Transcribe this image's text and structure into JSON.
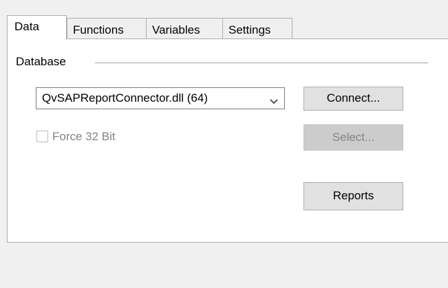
{
  "tabs": [
    {
      "label": "Data",
      "active": true
    },
    {
      "label": "Functions",
      "active": false
    },
    {
      "label": "Variables",
      "active": false
    },
    {
      "label": "Settings",
      "active": false
    }
  ],
  "database": {
    "group_label": "Database",
    "connector": {
      "selected": "QvSAPReportConnector.dll  (64)",
      "arrow_icon": "chevron-down-icon"
    },
    "force32": {
      "label": "Force 32 Bit",
      "checked": false,
      "enabled": false
    }
  },
  "buttons": {
    "connect": "Connect...",
    "select": "Select...",
    "reports": "Reports"
  },
  "colors": {
    "window_bg": "#f0f0f0",
    "panel_bg": "#ffffff",
    "border": "#adadad",
    "button_bg": "#e1e1e1",
    "disabled_text": "#838383"
  }
}
